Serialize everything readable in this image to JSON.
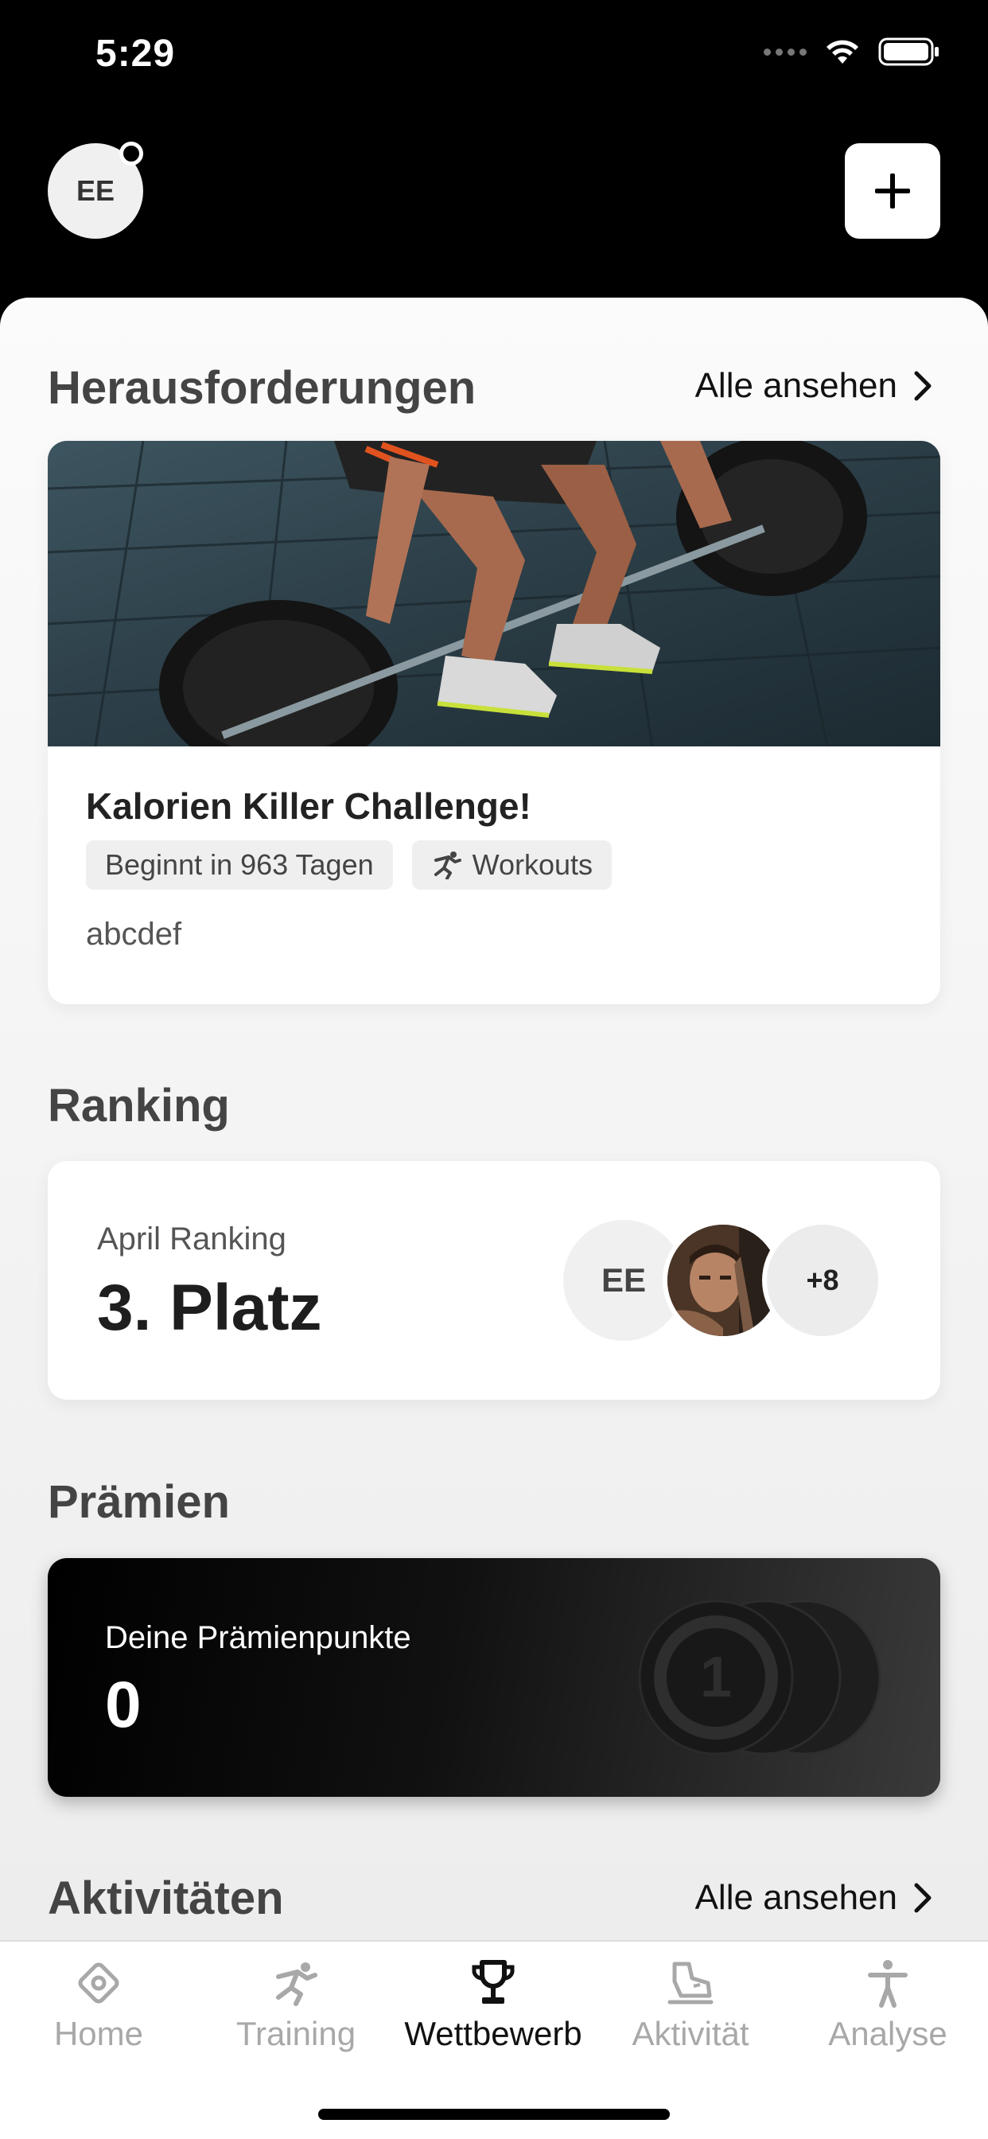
{
  "status_bar": {
    "time": "5:29"
  },
  "header": {
    "avatar_initials": "EE"
  },
  "challenges": {
    "title": "Herausforderungen",
    "see_all": "Alle ansehen",
    "card": {
      "title": "Kalorien Killer Challenge!",
      "chip_start": "Beginnt in 963 Tagen",
      "chip_type": "Workouts",
      "description": "abcdef"
    }
  },
  "ranking": {
    "title": "Ranking",
    "label": "April Ranking",
    "value": "3. Platz",
    "avatar_initials": "EE",
    "more_count": "+8"
  },
  "rewards": {
    "title": "Prämien",
    "label": "Deine Prämienpunkte",
    "value": "0",
    "coin_number": "1"
  },
  "activities": {
    "title": "Aktivitäten",
    "see_all": "Alle ansehen"
  },
  "tabs": [
    {
      "label": "Home",
      "icon": "home-icon",
      "active": false
    },
    {
      "label": "Training",
      "icon": "training-icon",
      "active": false
    },
    {
      "label": "Wettbewerb",
      "icon": "trophy-icon",
      "active": true
    },
    {
      "label": "Aktivität",
      "icon": "activity-icon",
      "active": false
    },
    {
      "label": "Analyse",
      "icon": "analysis-icon",
      "active": false
    }
  ],
  "colors": {
    "accent": "#000000",
    "inactive_tab": "#a8a8a8",
    "background": "#f4f4f4"
  }
}
